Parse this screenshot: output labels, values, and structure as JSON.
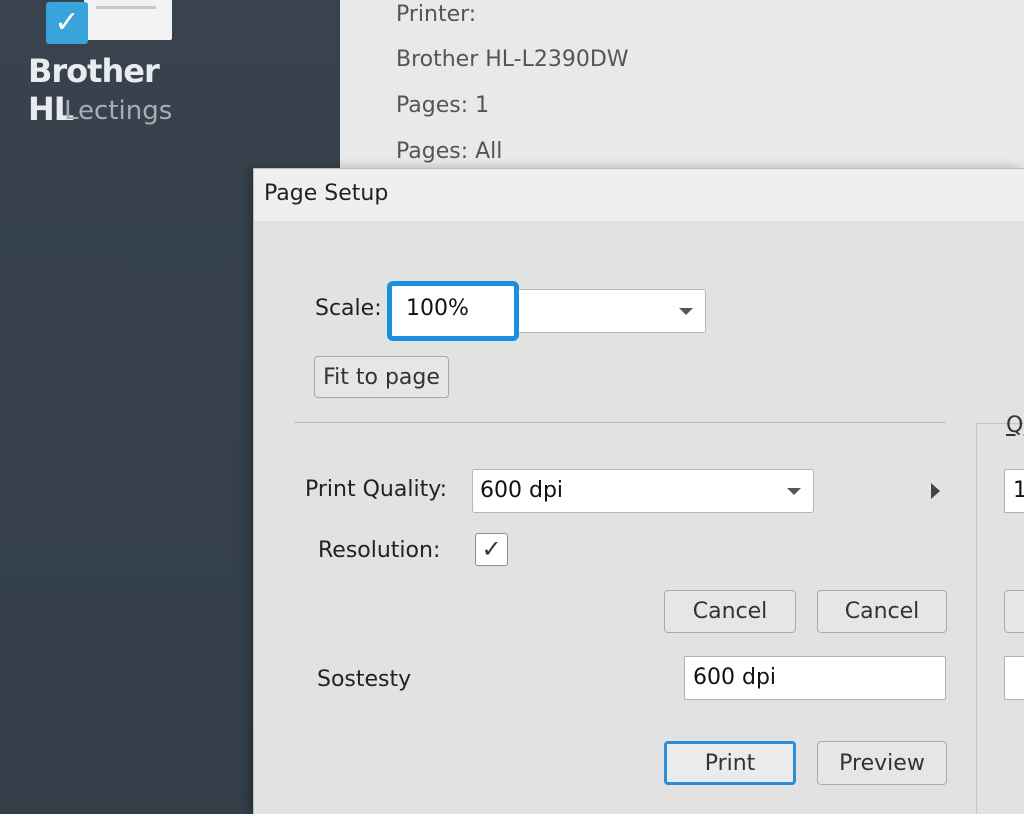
{
  "app": {
    "title": "Brother HL",
    "subtitle": "Lectings"
  },
  "printer_info": {
    "printer_label": "Printer:",
    "printer_name": "Brother HL-L2390DW",
    "pages_count": "Pages: 1",
    "pages_range": "Pages: All"
  },
  "dialog": {
    "title": "Page Setup",
    "scale_label": "Scale:",
    "scale_value": "100%",
    "fit_to_page": "Fit to page",
    "print_quality_label": "Print Quality:",
    "print_quality_value": "600 dpi",
    "resolution_label": "Resolution:",
    "resolution_checked": true,
    "cancel_1": "Cancel",
    "cancel_2": "Cancel",
    "sostesty_label": "Sostesty",
    "sostesty_value": "600 dpi",
    "print_button": "Print",
    "preview_button": "Preview",
    "right_section_label": "Q",
    "right_field_value": "1"
  },
  "colors": {
    "accent": "#1a8ee0",
    "sidebar": "#38434e",
    "logo_check": "#39a4dc"
  }
}
